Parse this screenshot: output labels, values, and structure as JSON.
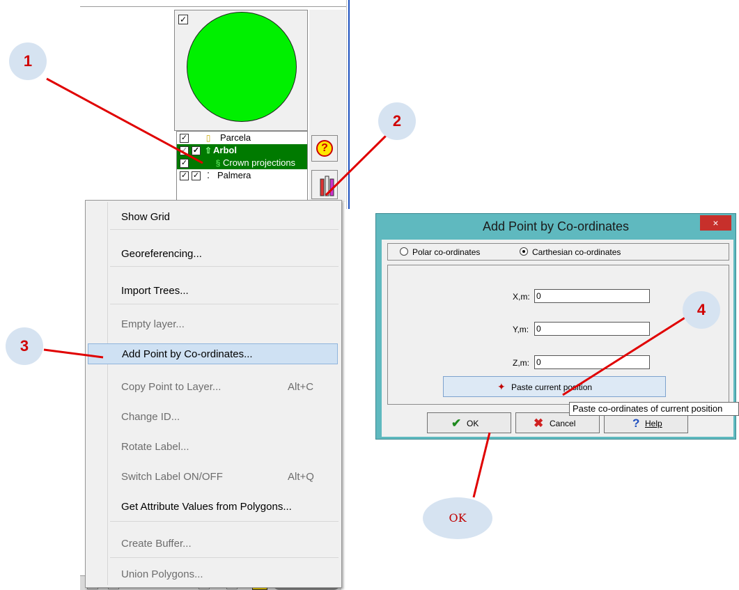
{
  "layers_panel": {
    "layers": [
      {
        "label": "Parcela",
        "icon": "rectangle-outline-icon"
      },
      {
        "label": "Arbol",
        "icon": "tree-icon"
      },
      {
        "label": "Crown projections",
        "icon": "crown-icon"
      },
      {
        "label": "Palmera",
        "icon": "points-icon"
      }
    ]
  },
  "context_menu": {
    "items": [
      {
        "label": "Show Grid",
        "disabled": false
      },
      {
        "label": "Georeferencing...",
        "disabled": false
      },
      {
        "label": "Import Trees...",
        "disabled": false
      },
      {
        "label": "Empty layer...",
        "disabled": true
      },
      {
        "label": "Add Point by Co-ordinates...",
        "disabled": false,
        "highlighted": true
      },
      {
        "label": "Copy Point to Layer...",
        "shortcut": "Alt+C",
        "disabled": true
      },
      {
        "label": "Change ID...",
        "disabled": true
      },
      {
        "label": "Rotate Label...",
        "disabled": true
      },
      {
        "label": "Switch Label ON/OFF",
        "shortcut": "Alt+Q",
        "disabled": true
      },
      {
        "label": "Get Attribute Values from Polygons...",
        "disabled": false
      },
      {
        "label": "Create Buffer...",
        "disabled": true
      },
      {
        "label": "Union Polygons...",
        "disabled": true
      }
    ]
  },
  "dialog": {
    "title": "Add Point by Co-ordinates",
    "close_label": "×",
    "radio_polar": "Polar co-ordinates",
    "radio_carthesian": "Carthesian co-ordinates",
    "selected_mode": "Carthesian co-ordinates",
    "x_label": "X,m:",
    "x_value": "0",
    "y_label": "Y,m:",
    "y_value": "0",
    "z_label": "Z,m:",
    "z_value": "0",
    "paste_button": "Paste current position",
    "ok_button": "OK",
    "cancel_button": "Cancel",
    "help_button": "Help"
  },
  "tooltip": "Paste co-ordinates of current position",
  "annotations": {
    "badge_1": "1",
    "badge_2": "2",
    "badge_3": "3",
    "badge_4": "4",
    "badge_ok": "OK"
  },
  "colors": {
    "layer_selected": "#007a00",
    "preview_circle": "#00f000",
    "dialog_frame": "#5fb9bf",
    "close_button": "#c7302b",
    "annotation_text": "#d00000",
    "annotation_badge": "#d6e3f1",
    "menu_highlight": "#cfe1f3"
  }
}
